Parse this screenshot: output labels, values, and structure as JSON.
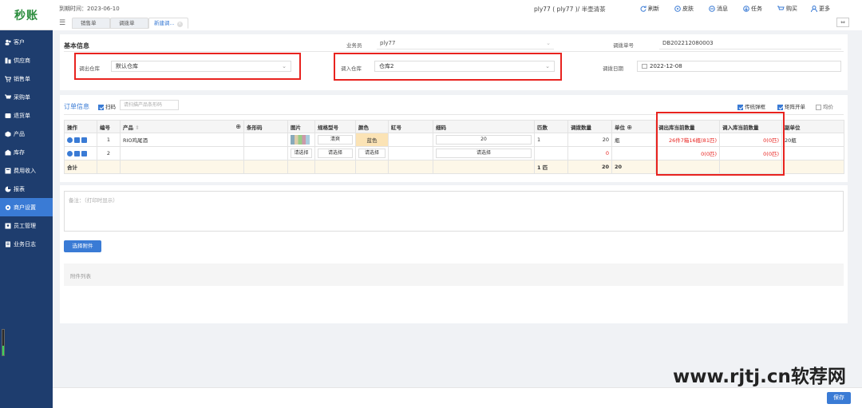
{
  "logo": "秒账",
  "expire_text": "到期时间：2023-06-10",
  "tabs": [
    {
      "label": "销售单"
    },
    {
      "label": "调拨单"
    },
    {
      "label": "新建调..."
    }
  ],
  "user_info": "ply77 ( ply77 )/ 半壶清茶",
  "toolbar": {
    "refresh": "刷新",
    "skin": "皮肤",
    "message": "消息",
    "task": "任务",
    "buy": "购买",
    "more": "更多"
  },
  "sidebar": {
    "items": [
      {
        "label": "客户",
        "icon": "users-icon"
      },
      {
        "label": "供应商",
        "icon": "supplier-icon"
      },
      {
        "label": "销售单",
        "icon": "cart-icon"
      },
      {
        "label": "采购单",
        "icon": "purchase-icon"
      },
      {
        "label": "退货单",
        "icon": "return-icon"
      },
      {
        "label": "产品",
        "icon": "product-icon"
      },
      {
        "label": "库存",
        "icon": "warehouse-icon"
      },
      {
        "label": "费用收入",
        "icon": "finance-icon"
      },
      {
        "label": "报表",
        "icon": "report-icon"
      },
      {
        "label": "商户设置",
        "icon": "gear-icon"
      },
      {
        "label": "员工管理",
        "icon": "staff-icon"
      },
      {
        "label": "业务日志",
        "icon": "log-icon"
      }
    ]
  },
  "basic": {
    "title": "基本信息",
    "salesman_label": "业务员",
    "salesman_value": "ply77",
    "order_no_label": "调拨单号",
    "order_no_value": "DB202212080003",
    "out_wh_label": "调出仓库",
    "out_wh_value": "默认仓库",
    "in_wh_label": "调入仓库",
    "in_wh_value": "仓库2",
    "date_label": "调拨日期",
    "date_value": "2022-12-08"
  },
  "order": {
    "title": "订单信息",
    "scan_label": "扫码",
    "scan_placeholder": "请扫描产品条形码",
    "opt_traditional": "传统弹框",
    "opt_matrix": "矩阵开单",
    "opt_avg": "均价"
  },
  "table": {
    "headers": [
      "操作",
      "编号",
      "产品",
      "条形码",
      "图片",
      "规格型号",
      "颜色",
      "缸号",
      "细码",
      "匹数",
      "调拨数量",
      "单位",
      "调出库当前数量",
      "调入库当前数量",
      "副单位"
    ],
    "rows": [
      {
        "no": "1",
        "product": "RIO鸡尾酒",
        "spec": "清爽",
        "color": "蓝色",
        "detail": "20",
        "pieces": "1",
        "qty": "20",
        "unit": "瓶",
        "out_stock": "26件7箱16瓶(81匹)",
        "in_stock": "0(0匹)",
        "sub_unit": "20瓶"
      },
      {
        "no": "2",
        "spec": "请选择",
        "color": "请选择",
        "detail": "请选择",
        "qty": "0",
        "out_stock": "0(0匹)",
        "in_stock": "0(0匹)",
        "img_btn": "请选择"
      }
    ],
    "sum": {
      "label": "合计",
      "pieces": "1 匹",
      "qty": "20",
      "unit": "20"
    }
  },
  "remark_placeholder": "备注：（打印时显示）",
  "attach_btn": "选择附件",
  "attach_list": "附件列表",
  "save": "保存",
  "watermark": "www.rjtj.cn软荐网",
  "colors": {
    "sidebar": "#1e3d6e",
    "accent": "#3a7bd5",
    "highlight": "#e8231f"
  }
}
